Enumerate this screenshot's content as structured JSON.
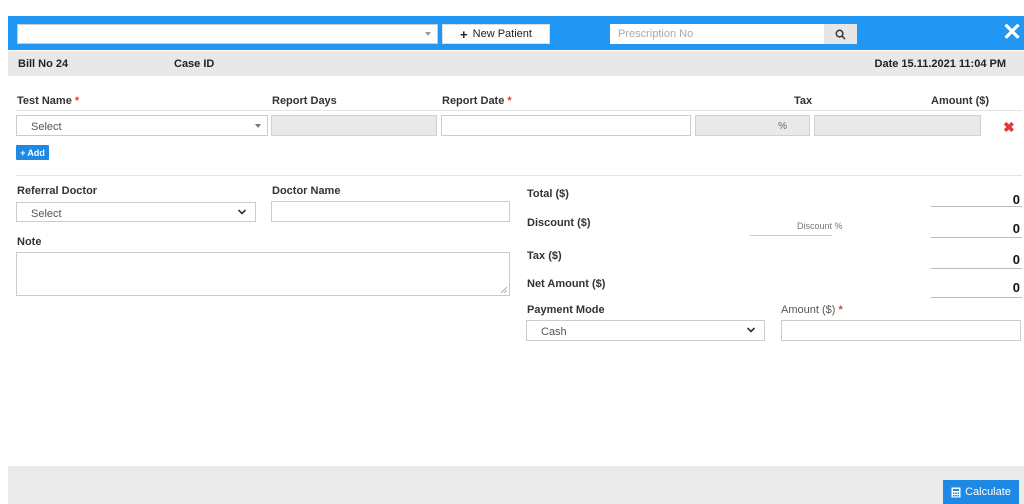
{
  "header": {
    "patient_select_value": "",
    "new_patient_label": "New Patient",
    "prescription_placeholder": "Prescription No"
  },
  "info": {
    "bill_no": "Bill No 24",
    "case_id": "Case ID",
    "date": "Date 15.11.2021 11:04 PM"
  },
  "tests": {
    "col_test_name": "Test Name",
    "col_report_days": "Report Days",
    "col_report_date": "Report Date",
    "col_tax": "Tax",
    "col_amount": "Amount ($)",
    "row": {
      "test_select": "Select",
      "report_days": "",
      "report_date": "",
      "tax_percent_symbol": "%",
      "amount": ""
    },
    "add_label": "Add"
  },
  "referral": {
    "label": "Referral Doctor",
    "value": "Select"
  },
  "doctor": {
    "label": "Doctor Name",
    "value": ""
  },
  "note": {
    "label": "Note",
    "value": ""
  },
  "summary": {
    "total_label": "Total ($)",
    "total_value": "0",
    "discount_label": "Discount ($)",
    "discount_pct_label": "Discount %",
    "discount_value": "0",
    "tax_label": "Tax ($)",
    "tax_value": "0",
    "net_label": "Net Amount ($)",
    "net_value": "0"
  },
  "payment": {
    "mode_label": "Payment Mode",
    "mode_value": "Cash",
    "amount_label": "Amount ($)",
    "amount_value": ""
  },
  "footer": {
    "calculate_label": "Calculate"
  },
  "colors": {
    "primary": "#2196f3",
    "button": "#1e88e5",
    "required": "#e53935"
  }
}
